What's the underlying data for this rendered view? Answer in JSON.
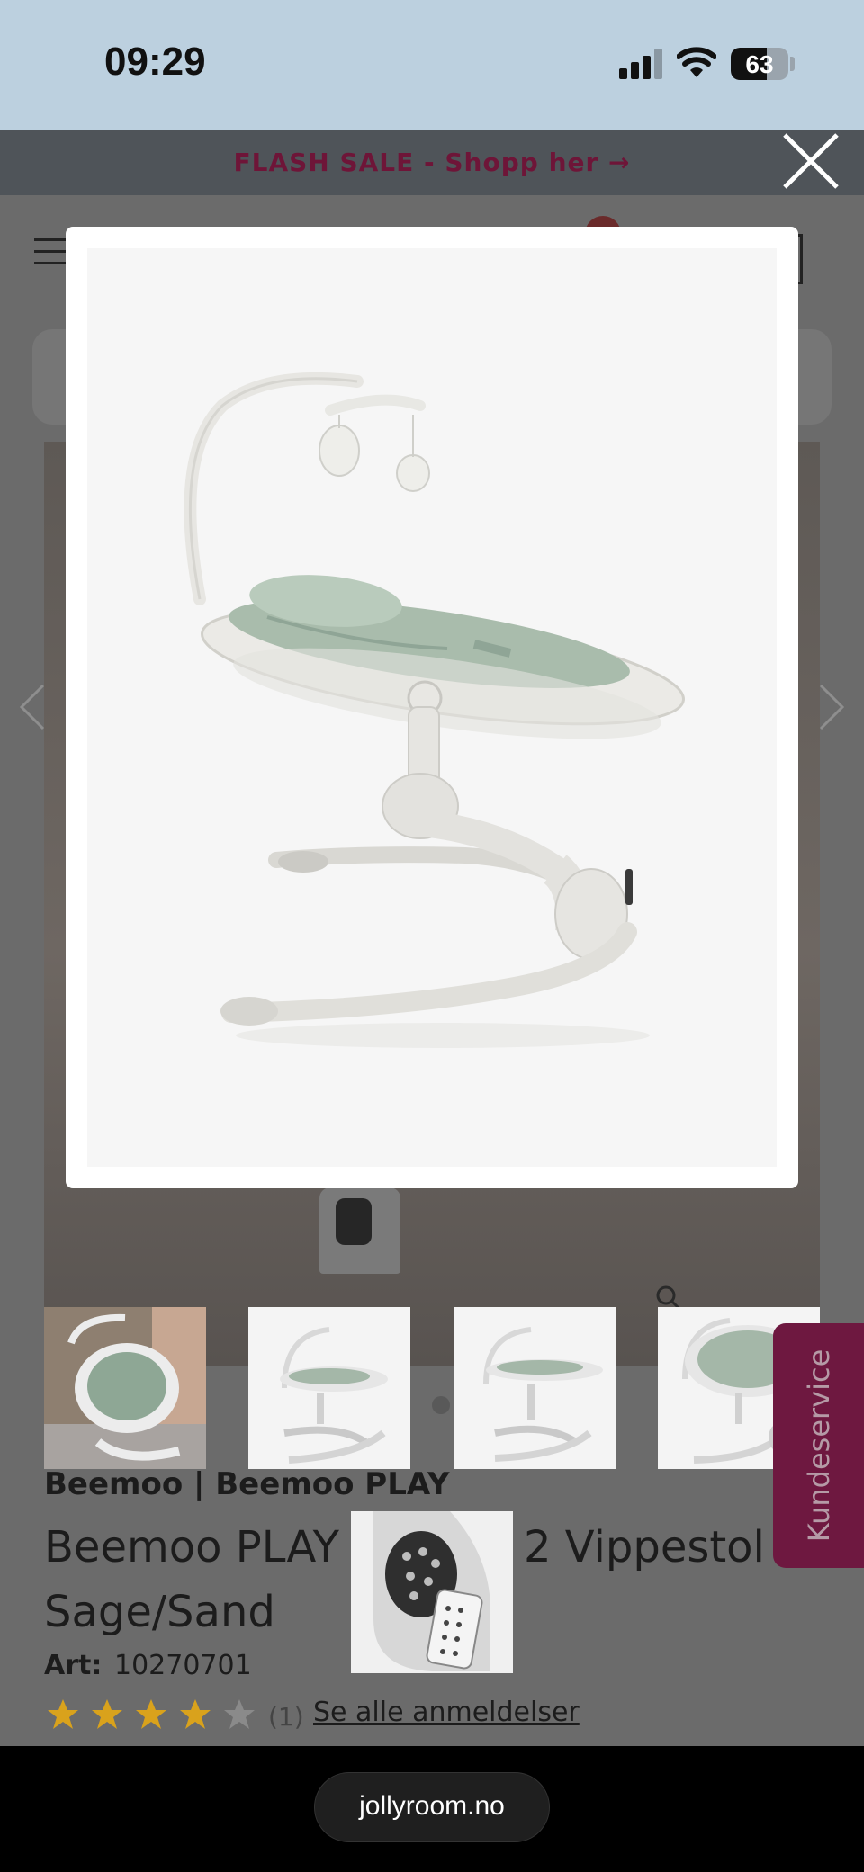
{
  "status_bar": {
    "time": "09:29",
    "battery": "63",
    "battery_level": 0.63
  },
  "banner": {
    "text": "FLASH SALE - Shopp her →"
  },
  "product": {
    "brand": "Beemoo | Beemoo PLAY",
    "title_line1_visible": "Beemoo PLAY",
    "title_line1_suffix": "2 Vippestol",
    "title_line2": "Sage/Sand",
    "art_label": "Art:",
    "art_number": "10270701",
    "rating": 4,
    "rating_max": 5,
    "review_count": "(1)",
    "reviews_link": "Se alle anmeldelser"
  },
  "side_tab": {
    "label": "Kundeservice"
  },
  "browser": {
    "url": "jollyroom.no"
  },
  "icons": [
    "close-icon",
    "menu-icon",
    "chevron-left-icon",
    "chevron-right-icon",
    "zoom-icon",
    "star-icon",
    "signal-icon",
    "wifi-icon",
    "battery-icon"
  ],
  "colors": {
    "banner_bg": "#4f5459",
    "banner_text": "#6e1538",
    "side_tab_bg": "#6e1840",
    "star": "#d9a21c",
    "status_bar_bg": "#bcd0df"
  }
}
